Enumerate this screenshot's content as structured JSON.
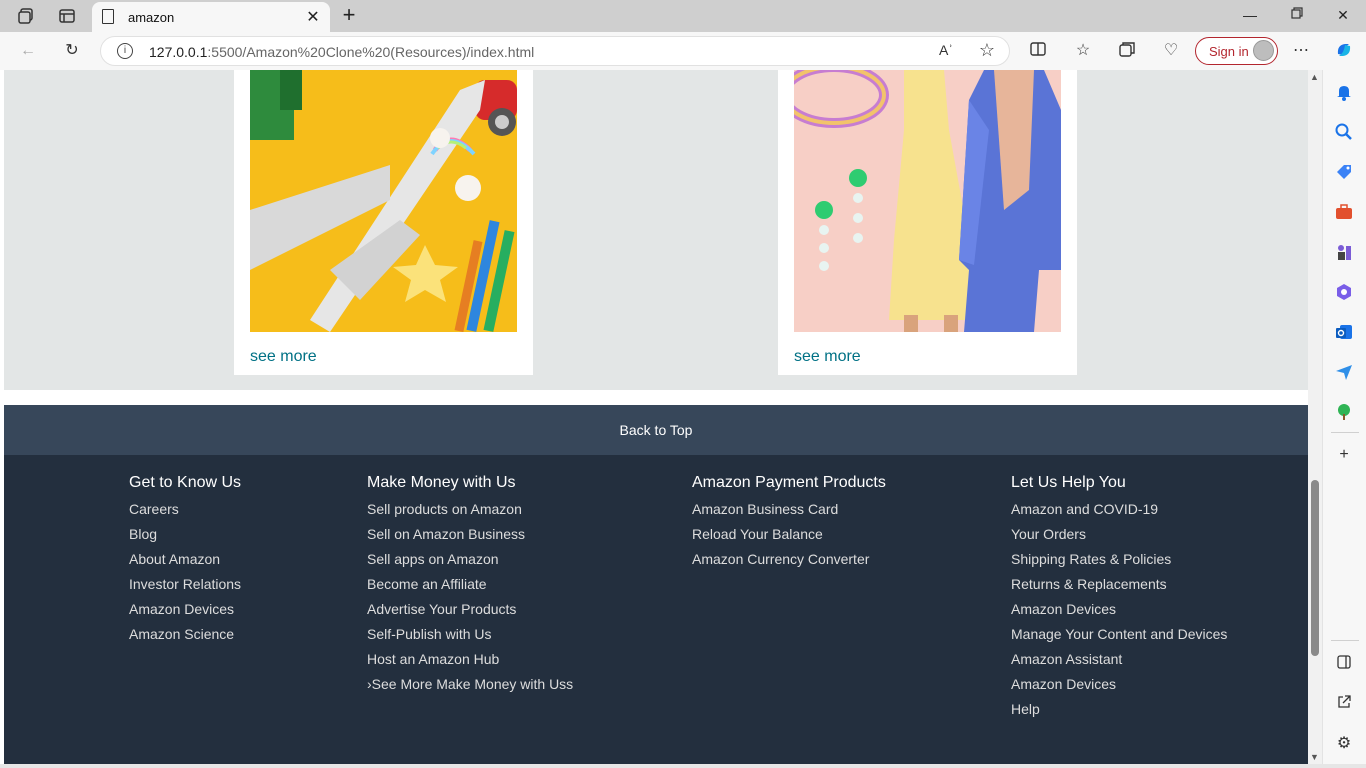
{
  "browser": {
    "tab_title": "amazon",
    "url_host": "127.0.0.1",
    "url_path": ":5500/Amazon%20Clone%20(Resources)/index.html",
    "sign_in_label": "Sign in",
    "read_aloud_label": "Aʾ"
  },
  "cards": [
    {
      "link": "see more"
    },
    {
      "link": "see more"
    }
  ],
  "back_to_top": "Back to Top",
  "footer": {
    "columns": [
      {
        "heading": "Get to Know Us",
        "links": [
          "Careers",
          "Blog",
          "About Amazon",
          "Investor Relations",
          "Amazon Devices",
          "Amazon Science"
        ]
      },
      {
        "heading": "Make Money with Us",
        "links": [
          "Sell products on Amazon",
          "Sell on Amazon Business",
          "Sell apps on Amazon",
          "Become an Affiliate",
          "Advertise Your Products",
          "Self-Publish with Us",
          "Host an Amazon Hub",
          "›See More Make Money with Uss"
        ]
      },
      {
        "heading": "Amazon Payment Products",
        "links": [
          "Amazon Business Card",
          "Reload Your Balance",
          "Amazon Currency Converter"
        ]
      },
      {
        "heading": "Let Us Help You",
        "links": [
          "Amazon and COVID-19",
          "Your Orders",
          "Shipping Rates & Policies",
          "Returns & Replacements",
          "Amazon Devices",
          "Manage Your Content and Devices",
          "Amazon Assistant",
          "Amazon Devices",
          "Help"
        ]
      }
    ]
  },
  "colors": {
    "link": "#007185",
    "footer_bg": "#232f3e",
    "back_to_top_bg": "#37475a",
    "grey_section": "#e3e6e6",
    "sign_in_accent": "#b3262e"
  }
}
